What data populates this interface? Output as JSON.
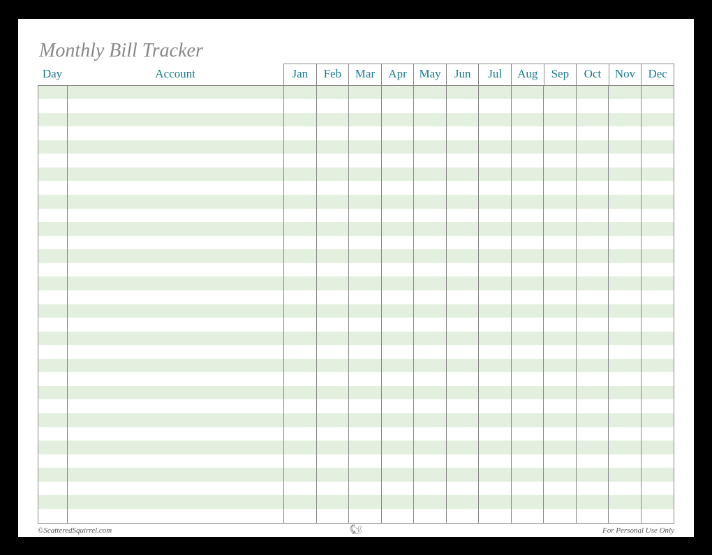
{
  "title": "Monthly Bill Tracker",
  "headers": {
    "day": "Day",
    "account": "Account",
    "months": [
      "Jan",
      "Feb",
      "Mar",
      "Apr",
      "May",
      "Jun",
      "Jul",
      "Aug",
      "Sep",
      "Oct",
      "Nov",
      "Dec"
    ]
  },
  "rows_count": 32,
  "footer": {
    "left": "©ScatteredSquirrel.com",
    "center_icon": "🐿",
    "right": "For Personal Use Only"
  }
}
